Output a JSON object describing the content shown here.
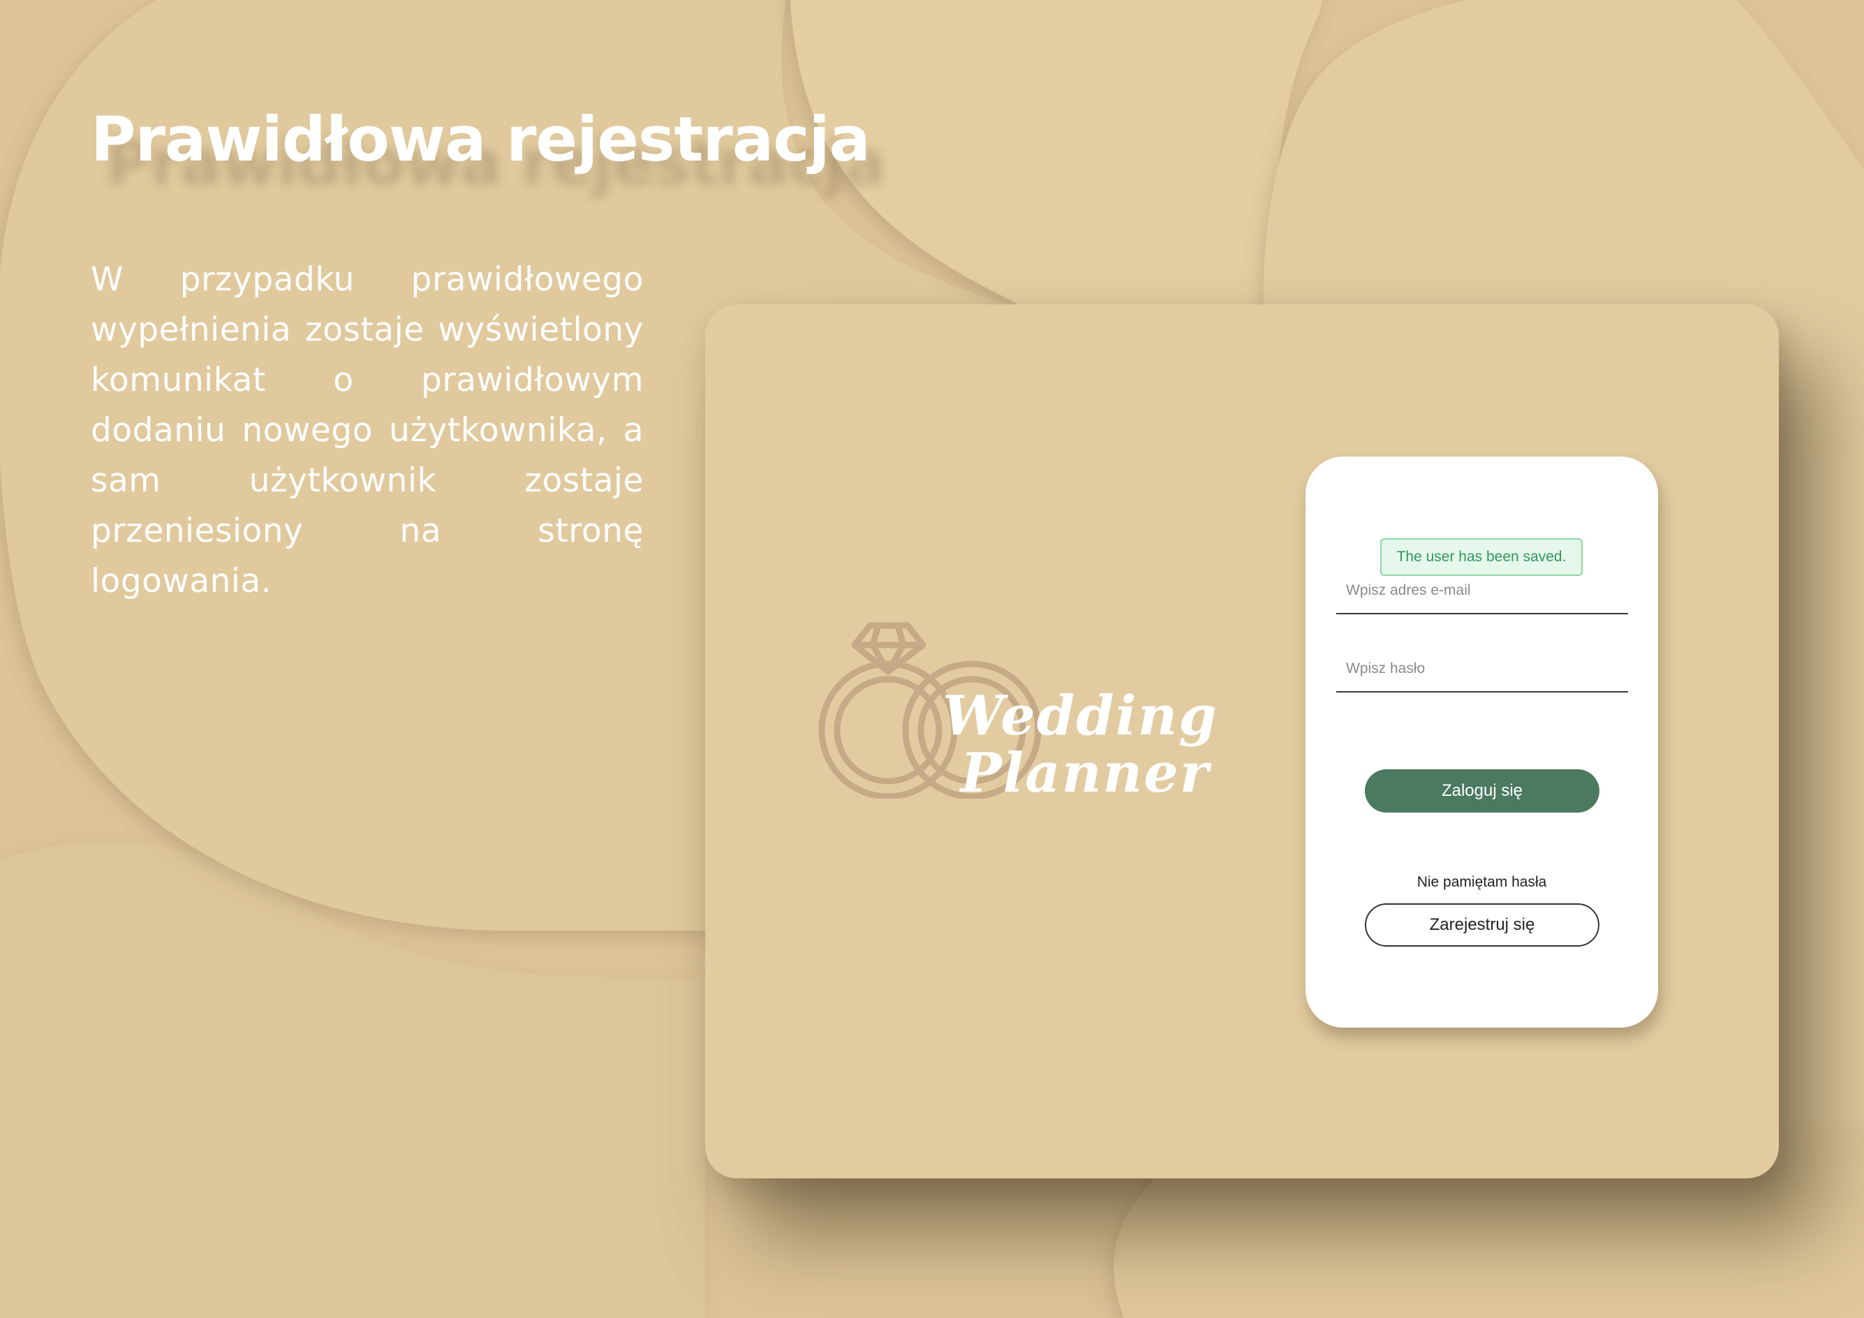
{
  "slide": {
    "title": "Prawidłowa rejestracja",
    "description": "W przypadku prawidłowego wypełnienia zostaje wyświetlony komunikat o prawidłowym dodaniu nowego użytkownika, a sam użytkownik zostaje przeniesiony na stronę logowania."
  },
  "app": {
    "logo": {
      "line1": "Wedding",
      "line2": "Planner",
      "icon": "wedding-rings-icon"
    },
    "login": {
      "alert": "The user has been saved.",
      "email_placeholder": "Wpisz adres e-mail",
      "password_placeholder": "Wpisz hasło",
      "login_button": "Zaloguj się",
      "forgot_password": "Nie pamiętam hasła",
      "register_button": "Zarejestruj się"
    }
  },
  "colors": {
    "background": "#e0c89c",
    "card": "#e2cba0",
    "primary_button": "#4b7a60",
    "success_text": "#2e9a59",
    "success_border": "#8bd7a6",
    "success_background": "#e6f7ec"
  }
}
